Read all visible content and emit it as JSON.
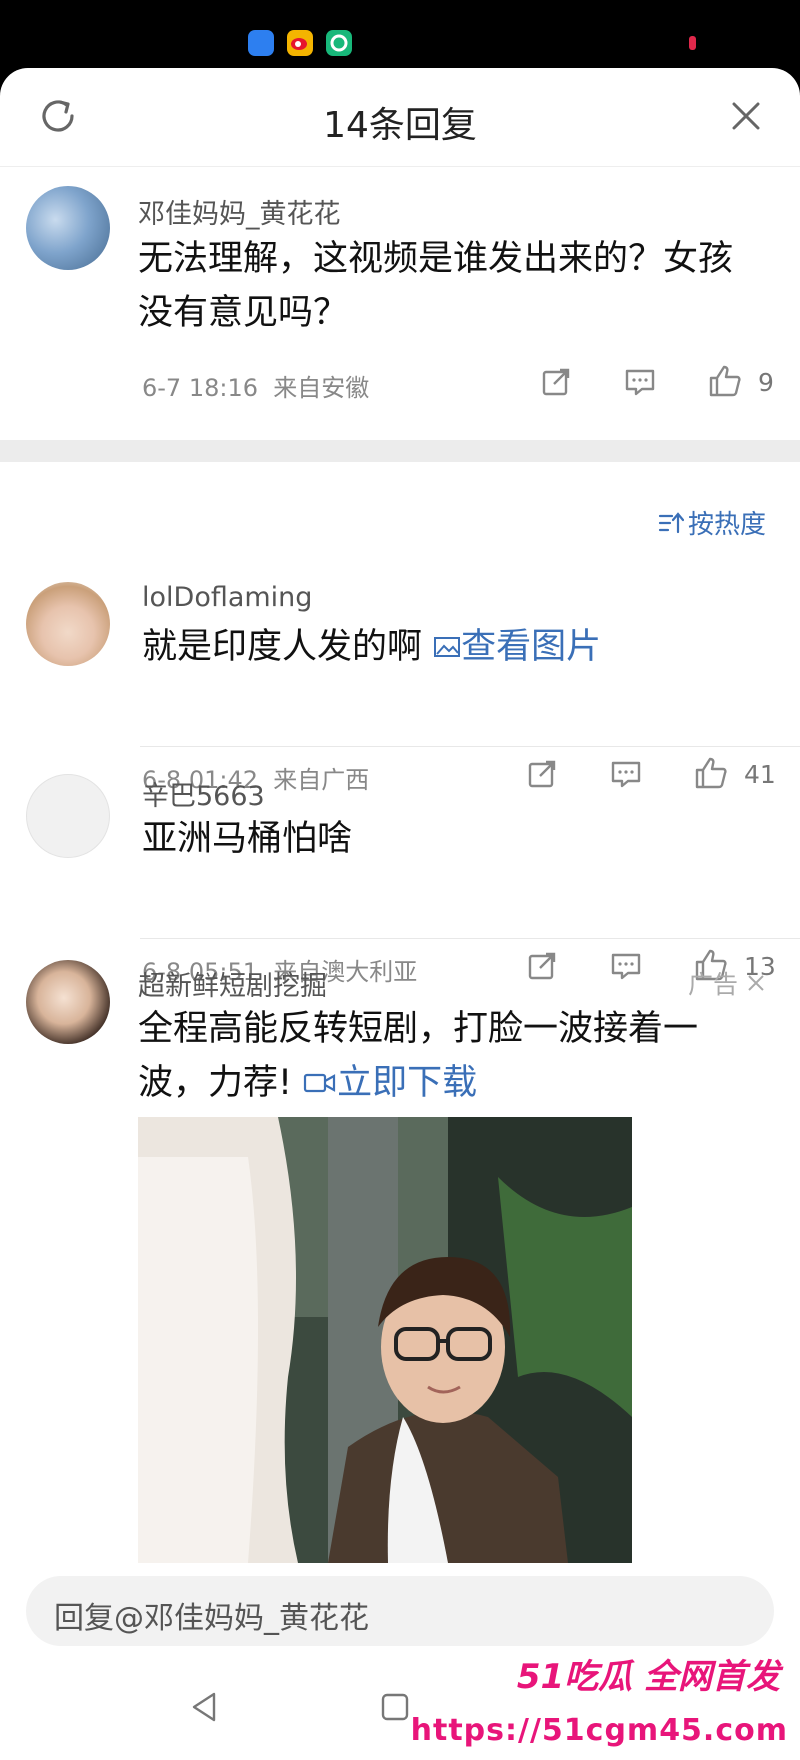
{
  "header": {
    "title": "14条回复"
  },
  "main_comment": {
    "username": "邓佳妈妈_黄花花",
    "text": "无法理解，这视频是谁发出来的？女孩没有意见吗？",
    "date": "6-7 18:16",
    "location": "来自安徽",
    "likes": "9"
  },
  "sort_label": "按热度",
  "replies": [
    {
      "username": "lolDoflaming",
      "text": "就是印度人发的啊",
      "link": "查看图片",
      "date": "6-8 01:42",
      "location": "来自广西",
      "likes": "41"
    },
    {
      "username": "辛巴5663",
      "text": "亚洲马桶怕啥",
      "date": "6-8 05:51",
      "location": "来自澳大利亚",
      "likes": "13"
    }
  ],
  "ad": {
    "username": "超新鲜短剧挖掘",
    "tag": "广告",
    "text": "全程高能反转短剧，打脸一波接着一波，力荐!",
    "link": "立即下载"
  },
  "reply_bar": {
    "placeholder": "回复@邓佳妈妈_黄花花"
  },
  "watermark": {
    "line1": "51吃瓜 全网首发",
    "line2": "https://51cgm45.com"
  },
  "colors": {
    "link": "#3a6fb7",
    "watermark": "#e8157a"
  }
}
